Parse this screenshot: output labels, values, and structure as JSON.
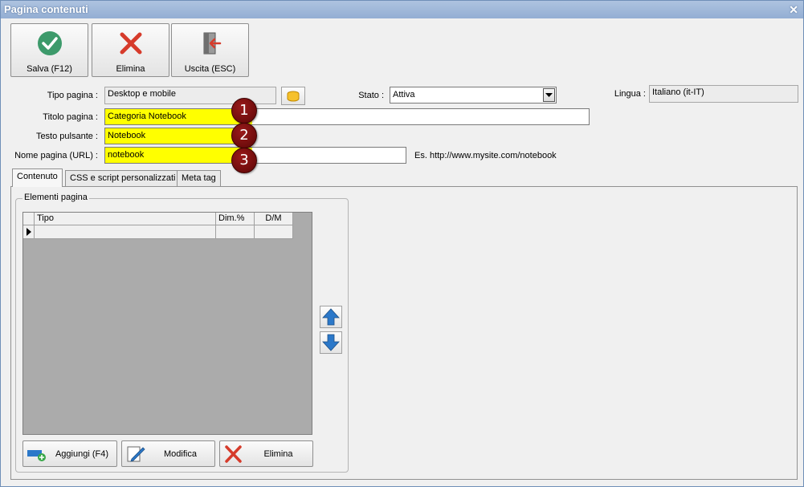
{
  "window": {
    "title": "Pagina contenuti",
    "close_glyph": "✕"
  },
  "toolbar": {
    "save_label": "Salva (F12)",
    "delete_label": "Elimina",
    "exit_label": "Uscita (ESC)"
  },
  "form": {
    "page_type_label": "Tipo pagina :",
    "page_type_value": "Desktop e mobile",
    "status_label": "Stato :",
    "status_value": "Attiva",
    "language_label": "Lingua :",
    "language_value": "Italiano (it-IT)",
    "title_label": "Titolo pagina :",
    "title_value": "Categoria Notebook",
    "button_text_label": "Testo pulsante :",
    "button_text_value": "Notebook",
    "url_label": "Nome pagina (URL) :",
    "url_value": "notebook",
    "url_example": "Es. http://www.mysite.com/notebook"
  },
  "badges": [
    "1",
    "2",
    "3"
  ],
  "tabs": [
    {
      "label": "Contenuto",
      "active": true
    },
    {
      "label": "CSS e script personalizzati",
      "active": false
    },
    {
      "label": "Meta tag",
      "active": false
    }
  ],
  "elements_group": {
    "legend": "Elementi pagina",
    "columns": [
      "Tipo",
      "Dim.%",
      "D/M"
    ],
    "add_label": "Aggiungi (F4)",
    "edit_label": "Modifica",
    "delete_label": "Elimina"
  },
  "colors": {
    "highlight": "#ffff00",
    "title_bar": "#93aed3",
    "badge": "#7a0e0e"
  }
}
